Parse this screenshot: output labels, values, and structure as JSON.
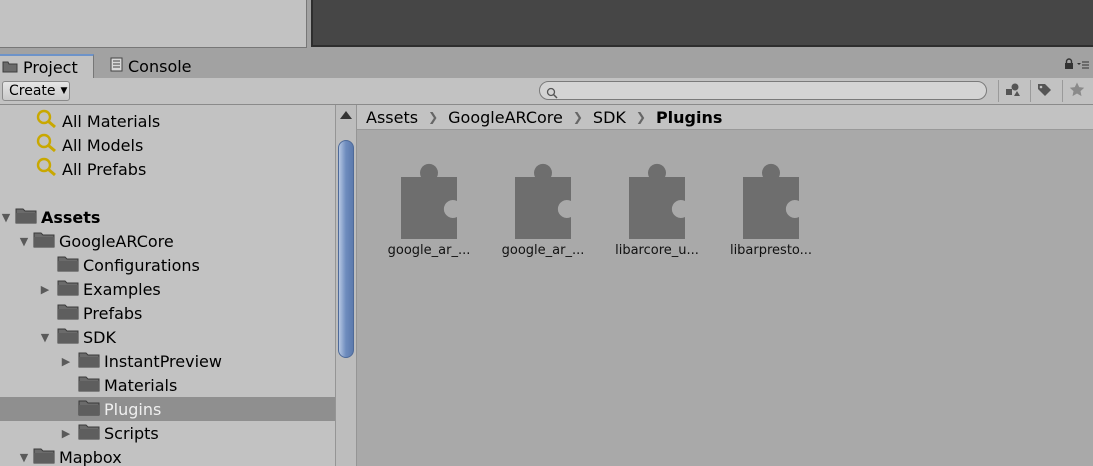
{
  "tabs": [
    {
      "label": "Project",
      "icon": "folder-icon",
      "active": true
    },
    {
      "label": "Console",
      "icon": "console-icon",
      "active": false
    }
  ],
  "toolbar": {
    "create_label": "Create",
    "search_placeholder": ""
  },
  "tree": {
    "favorites": [
      "All Materials",
      "All Models",
      "All Prefabs"
    ],
    "items": [
      {
        "label": "Assets",
        "depth": 0,
        "expanded": true,
        "bold": true
      },
      {
        "label": "GoogleARCore",
        "depth": 1,
        "expanded": true
      },
      {
        "label": "Configurations",
        "depth": 2,
        "expanded": null
      },
      {
        "label": "Examples",
        "depth": 2,
        "expanded": false
      },
      {
        "label": "Prefabs",
        "depth": 2,
        "expanded": null
      },
      {
        "label": "SDK",
        "depth": 2,
        "expanded": true
      },
      {
        "label": "InstantPreview",
        "depth": 3,
        "expanded": false
      },
      {
        "label": "Materials",
        "depth": 3,
        "expanded": null
      },
      {
        "label": "Plugins",
        "depth": 3,
        "expanded": null,
        "selected": true
      },
      {
        "label": "Scripts",
        "depth": 3,
        "expanded": false
      },
      {
        "label": "Mapbox",
        "depth": 1,
        "expanded": true
      }
    ]
  },
  "breadcrumb": [
    "Assets",
    "GoogleARCore",
    "SDK",
    "Plugins"
  ],
  "assets": [
    {
      "label": "google_ar_...",
      "icon": "plugin-puzzle-icon"
    },
    {
      "label": "google_ar_...",
      "icon": "plugin-puzzle-icon"
    },
    {
      "label": "libarcore_u...",
      "icon": "plugin-puzzle-icon"
    },
    {
      "label": "libarpresto...",
      "icon": "plugin-puzzle-icon"
    }
  ],
  "colors": {
    "panel": "#c2c2c2",
    "content_bg": "#a9a9a9",
    "selection": "#8f8f8f",
    "tab_accent": "#6d93c9",
    "scroll_thumb": "#6d8bbd"
  }
}
